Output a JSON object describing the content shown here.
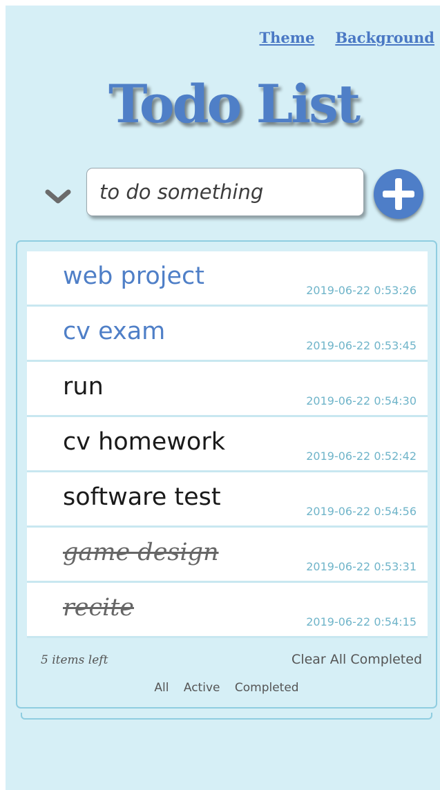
{
  "header": {
    "theme_link": "Theme",
    "background_link": "Background",
    "title": "Todo List"
  },
  "input": {
    "placeholder": "to do something",
    "value": ""
  },
  "todos": [
    {
      "text": "web project",
      "time": "2019-06-22 0:53:26",
      "state": "editing"
    },
    {
      "text": "cv exam",
      "time": "2019-06-22 0:53:45",
      "state": "editing"
    },
    {
      "text": "run",
      "time": "2019-06-22 0:54:30",
      "state": "active"
    },
    {
      "text": "cv homework",
      "time": "2019-06-22 0:52:42",
      "state": "active"
    },
    {
      "text": "software test",
      "time": "2019-06-22 0:54:56",
      "state": "active"
    },
    {
      "text": "game design",
      "time": "2019-06-22 0:53:31",
      "state": "completed"
    },
    {
      "text": "recite",
      "time": "2019-06-22 0:54:15",
      "state": "completed"
    }
  ],
  "footer": {
    "items_left": "5 items left",
    "clear_completed": "Clear All Completed",
    "filters": [
      "All",
      "Active",
      "Completed"
    ]
  },
  "icons": {
    "toggle_all": "chevron-down-icon",
    "add": "plus-circle-icon"
  },
  "colors": {
    "background": "#d6eff6",
    "accent": "#4f7fc7",
    "timestamp": "#6fb4c9",
    "border": "#8fcde0"
  }
}
